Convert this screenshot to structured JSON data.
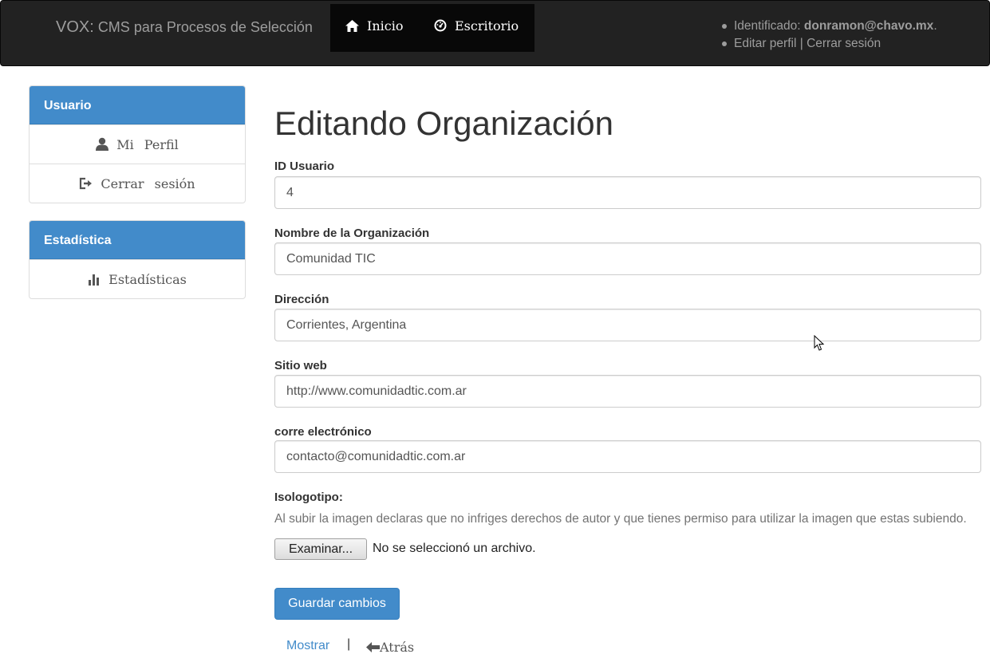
{
  "navbar": {
    "brand_main": "VOX:",
    "brand_sub": "CMS para Procesos de Selección",
    "nav": [
      {
        "label": "Inicio",
        "icon": "home-icon"
      },
      {
        "label": "Escritorio",
        "icon": "dashboard-icon"
      }
    ],
    "user": {
      "identified_label": "Identificado:",
      "email": "donramon@chavo.mx",
      "email_suffix": ".",
      "edit_profile": "Editar perfil",
      "separator": "|",
      "logout": "Cerrar sesión"
    }
  },
  "sidebar": {
    "panels": [
      {
        "heading": "Usuario",
        "items": [
          {
            "label": "Mi Perfil",
            "icon": "user-icon"
          },
          {
            "label": "Cerrar sesión",
            "icon": "logout-icon"
          }
        ]
      },
      {
        "heading": "Estadística",
        "items": [
          {
            "label": "Estadísticas",
            "icon": "bar-chart-icon"
          }
        ]
      }
    ]
  },
  "main": {
    "title": "Editando Organización",
    "fields": [
      {
        "label": "ID Usuario",
        "value": "4"
      },
      {
        "label": "Nombre de la Organización",
        "value": "Comunidad TIC"
      },
      {
        "label": "Dirección",
        "value": "Corrientes, Argentina"
      },
      {
        "label": "Sitio web",
        "value": "http://www.comunidadtic.com.ar"
      },
      {
        "label": "corre electrónico",
        "value": "contacto@comunidadtic.com.ar"
      }
    ],
    "logo": {
      "label": "Isologotipo:",
      "help": "Al subir la imagen declaras que no infriges derechos de autor y que tienes permiso para utilizar la imagen que estas subiendo.",
      "browse_button": "Examinar...",
      "no_file": "No se seleccionó un archivo."
    },
    "save_button": "Guardar cambios",
    "show_link": "Mostrar",
    "link_separator": "|",
    "back_link": "Atrás"
  },
  "colors": {
    "navbar_bg": "#222222",
    "primary": "#428bca",
    "text": "#333333"
  }
}
